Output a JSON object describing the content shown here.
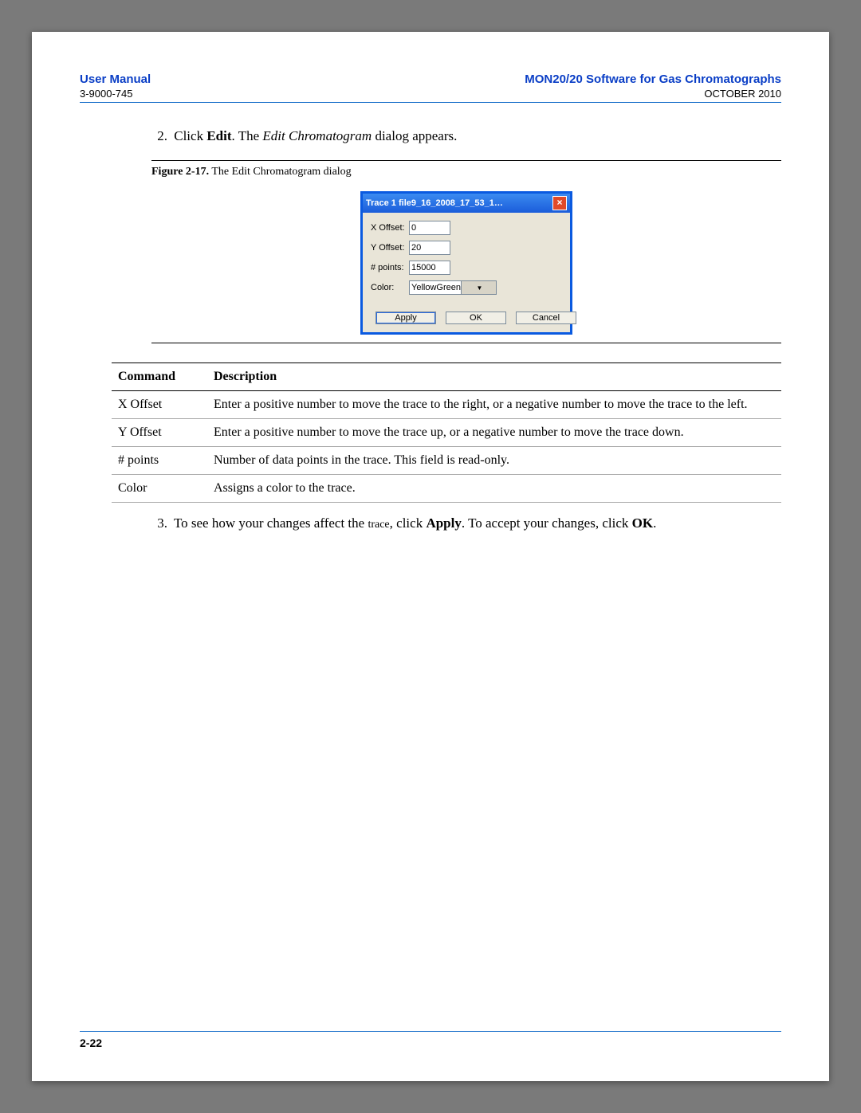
{
  "header": {
    "left_title": "User Manual",
    "left_sub": "3-9000-745",
    "right_title": "MON20/20 Software for Gas Chromatographs",
    "right_sub": "OCTOBER 2010"
  },
  "step2": {
    "num": "2.",
    "pre": "Click ",
    "bold": "Edit",
    "mid": ". The ",
    "ital": "Edit Chromatogram",
    "post": " dialog appears."
  },
  "figure": {
    "label": "Figure 2-17.",
    "caption": "The Edit Chromatogram dialog"
  },
  "dialog": {
    "title": "Trace 1 file9_16_2008_17_53_1…",
    "rows": {
      "x_offset_label": "X Offset:",
      "x_offset_value": "0",
      "y_offset_label": "Y Offset:",
      "y_offset_value": "20",
      "points_label": "# points:",
      "points_value": "15000",
      "color_label": "Color:",
      "color_value": "YellowGreen"
    },
    "buttons": {
      "apply": "Apply",
      "ok": "OK",
      "cancel": "Cancel"
    }
  },
  "table": {
    "head_command": "Command",
    "head_description": "Description",
    "rows": [
      {
        "cmd": "X Offset",
        "desc": "Enter a positive number to move the trace to the right, or a negative number to move the trace to the left."
      },
      {
        "cmd": "Y Offset",
        "desc": "Enter a positive number to move the trace up, or a negative number to move the trace down."
      },
      {
        "cmd": "# points",
        "desc": "Number of data points in the trace.  This field is read-only."
      },
      {
        "cmd": "Color",
        "desc": "Assigns a color to the trace."
      }
    ]
  },
  "step3": {
    "num": "3.",
    "t1": "To see how your changes affect the ",
    "trace": "trace",
    "t2": ", click ",
    "apply": "Apply",
    "t3": ".  To accept your changes, click ",
    "ok": "OK",
    "t4": "."
  },
  "footer": {
    "page": "2-22"
  }
}
